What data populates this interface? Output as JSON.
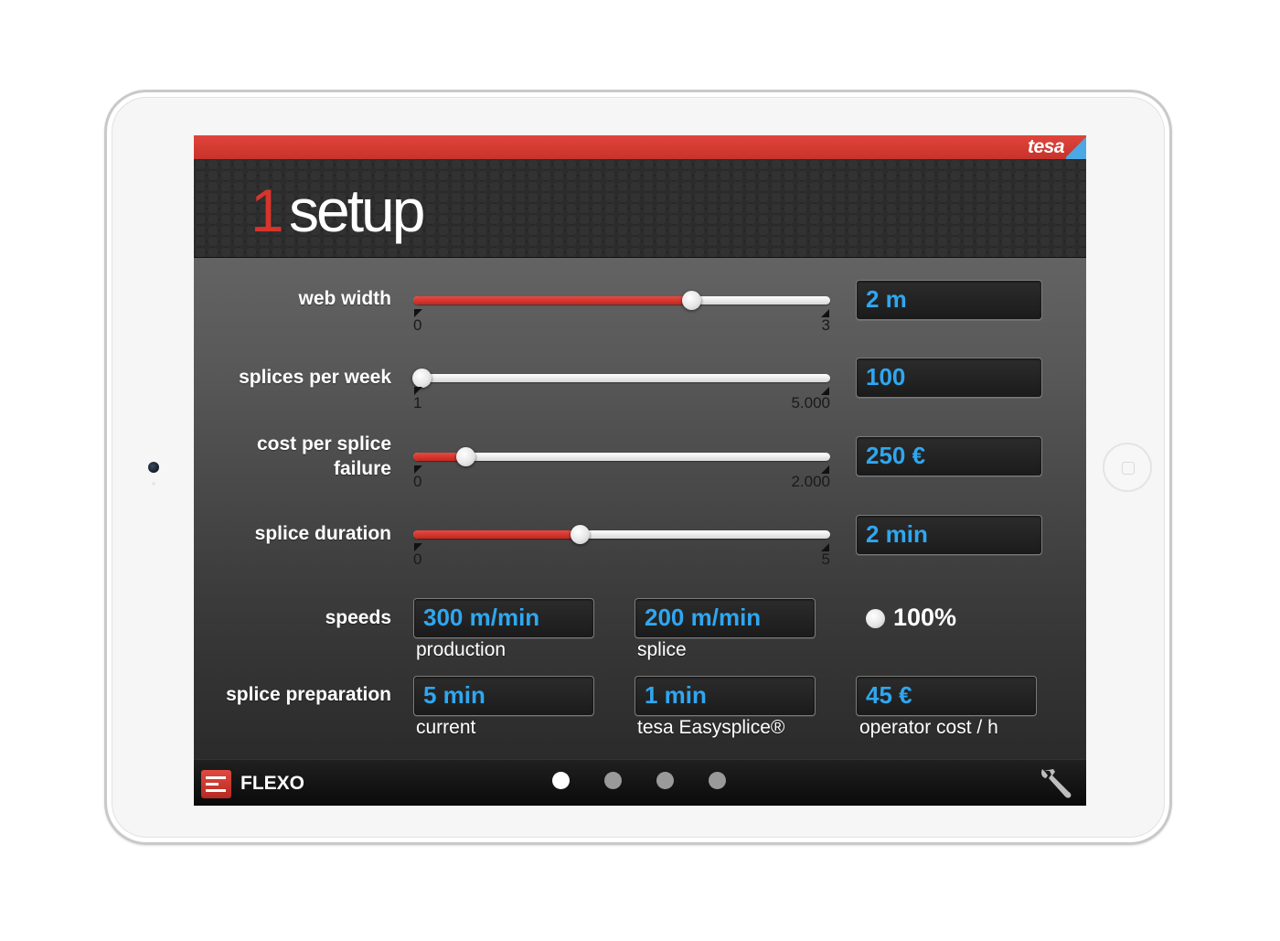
{
  "brand": {
    "logo": "tesa"
  },
  "header": {
    "number": "1",
    "title": "setup"
  },
  "sliders": [
    {
      "label": "web width",
      "min": "0",
      "max": "3",
      "value": "2 m",
      "fraction": 0.667
    },
    {
      "label": "splices per week",
      "min": "1",
      "max": "5.000",
      "value": "100",
      "fraction": 0.02
    },
    {
      "label_line1": "cost per splice",
      "label_line2": "failure",
      "min": "0",
      "max": "2.000",
      "value": "250 €",
      "fraction": 0.125
    },
    {
      "label": "splice duration",
      "min": "0",
      "max": "5",
      "value": "2 min",
      "fraction": 0.4
    }
  ],
  "speeds": {
    "label": "speeds",
    "production": {
      "value": "300 m/min",
      "caption": "production"
    },
    "splice": {
      "value": "200 m/min",
      "caption": "splice"
    },
    "toggle_label": "100%"
  },
  "splice_preparation": {
    "label": "splice preparation",
    "current": {
      "value": "5 min",
      "caption": "current"
    },
    "easysplice": {
      "value": "1 min",
      "caption": "tesa Easysplice®"
    },
    "operator": {
      "value": "45 €",
      "caption": "operator cost / h"
    }
  },
  "bottom": {
    "app_label": "FLEXO",
    "pages": 4,
    "active_page": 1,
    "settings_icon": "wrench-icon"
  }
}
